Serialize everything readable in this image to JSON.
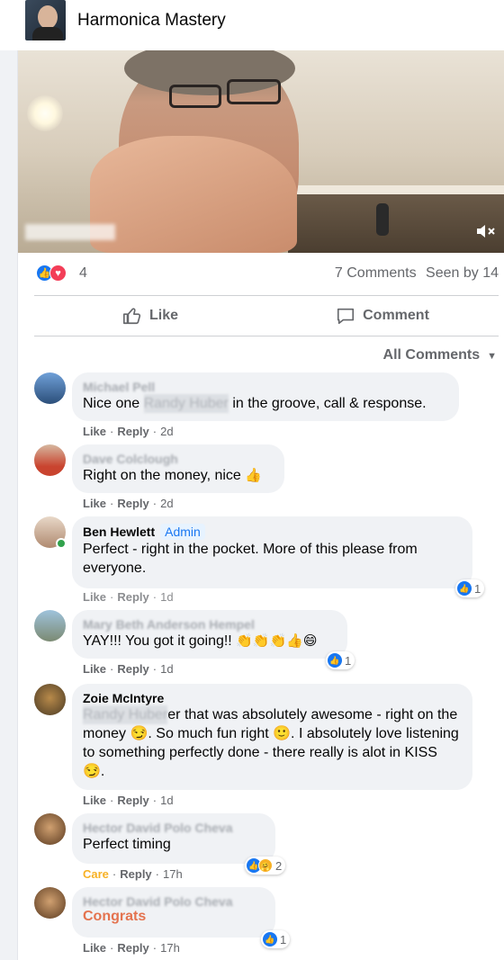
{
  "header": {
    "title": "Harmonica Mastery"
  },
  "post": {
    "reaction_count": "4",
    "comments_count": "7 Comments",
    "seen_by": "Seen by 14"
  },
  "actions": {
    "like": "Like",
    "comment": "Comment"
  },
  "filter": {
    "label": "All Comments"
  },
  "comments": [
    {
      "name": "Michael Pell",
      "text_before": "Nice one ",
      "redacted": "Randy Huber",
      "text_after": " in the groove, call & response.",
      "like": "Like",
      "reply": "Reply",
      "time": "2d"
    },
    {
      "name": "Dave Colclough",
      "text": "Right on the money, nice",
      "emoji": "👍",
      "like": "Like",
      "reply": "Reply",
      "time": "2d"
    },
    {
      "name": "Ben Hewlett",
      "badge": "Admin",
      "text": "Perfect - right in the pocket. More of this please from everyone.",
      "like": "Like",
      "reply": "Reply",
      "time": "1d",
      "reactions": "1"
    },
    {
      "name": "Mary Beth Anderson Hempel",
      "text": "YAY!!! You got it going!!",
      "emoji": "👏👏👏👍😄",
      "like": "Like",
      "reply": "Reply",
      "time": "1d",
      "reactions": "1"
    },
    {
      "name": "Zoie McIntyre",
      "redacted": "Randy Huber",
      "text": "er that was absolutely awesome - right on the money 😏. So much fun right 🙂. I absolutely love listening to something perfectly done - there really is alot in KISS 😏.",
      "like": "Like",
      "reply": "Reply",
      "time": "1d"
    },
    {
      "name": "Hector David Polo Cheva",
      "text": "Perfect timing",
      "care": "Care",
      "reply": "Reply",
      "time": "17h",
      "reactions": "2"
    },
    {
      "name": "Hector David Polo Cheva",
      "text": "Congrats",
      "like": "Like",
      "reply": "Reply",
      "time": "17h",
      "reactions": "1"
    }
  ]
}
